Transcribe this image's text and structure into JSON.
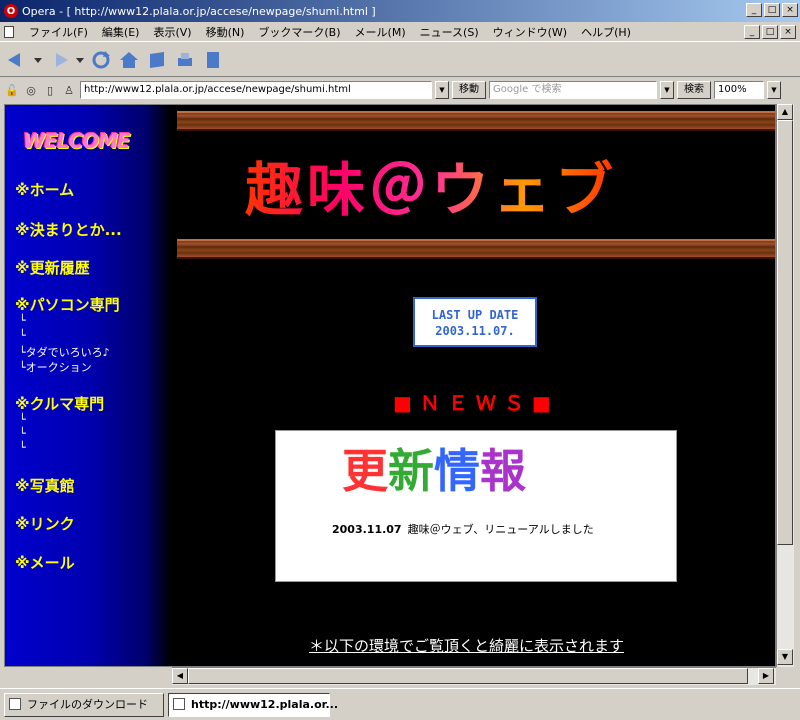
{
  "window": {
    "title": "Opera - [ http://www12.plala.or.jp/accese/newpage/shumi.html ]",
    "app_icon_letter": "O",
    "minimize": "_",
    "maximize": "□",
    "close": "×"
  },
  "menu": [
    "ファイル(F)",
    "編集(E)",
    "表示(V)",
    "移動(N)",
    "ブックマーク(B)",
    "メール(M)",
    "ニュース(S)",
    "ウィンドウ(W)",
    "ヘルプ(H)"
  ],
  "address": {
    "url": "http://www12.plala.or.jp/accese/newpage/shumi.html",
    "go_label": "移動",
    "search_placeholder": "Google で検索",
    "search_label": "検索",
    "zoom": "100%"
  },
  "sidebar": {
    "welcome": "WELCOME",
    "nav": [
      {
        "label": "※ホーム"
      },
      {
        "label": "※決まりとか..."
      },
      {
        "label": "※更新履歴"
      },
      {
        "label": "※パソコン専門"
      }
    ],
    "pc_sub": [
      "└",
      "└",
      "└タダでいろいろ♪",
      "└オークション"
    ],
    "car": "※クルマ専門",
    "car_sub": [
      "└",
      "└",
      "└"
    ],
    "nav2": [
      {
        "label": "※写真館"
      },
      {
        "label": "※リンク"
      },
      {
        "label": "※メール"
      }
    ]
  },
  "main": {
    "logo": "趣味＠ウェブ",
    "last_up_label": "LAST UP DATE",
    "last_up_date": "2003.11.07.",
    "news_heading": "■ＮＥＷＳ■",
    "update_banner": [
      "更",
      "新",
      "情",
      "報"
    ],
    "news_items": [
      {
        "date": "2003.11.07",
        "text": "趣味＠ウェブ、リニューアルしました"
      }
    ],
    "env_link": "＊以下の環境でご覧頂くと綺麗に表示されます"
  },
  "status": {
    "tab_downloads": "ファイルのダウンロード",
    "tab_page": "http://www12.plala.or..."
  }
}
